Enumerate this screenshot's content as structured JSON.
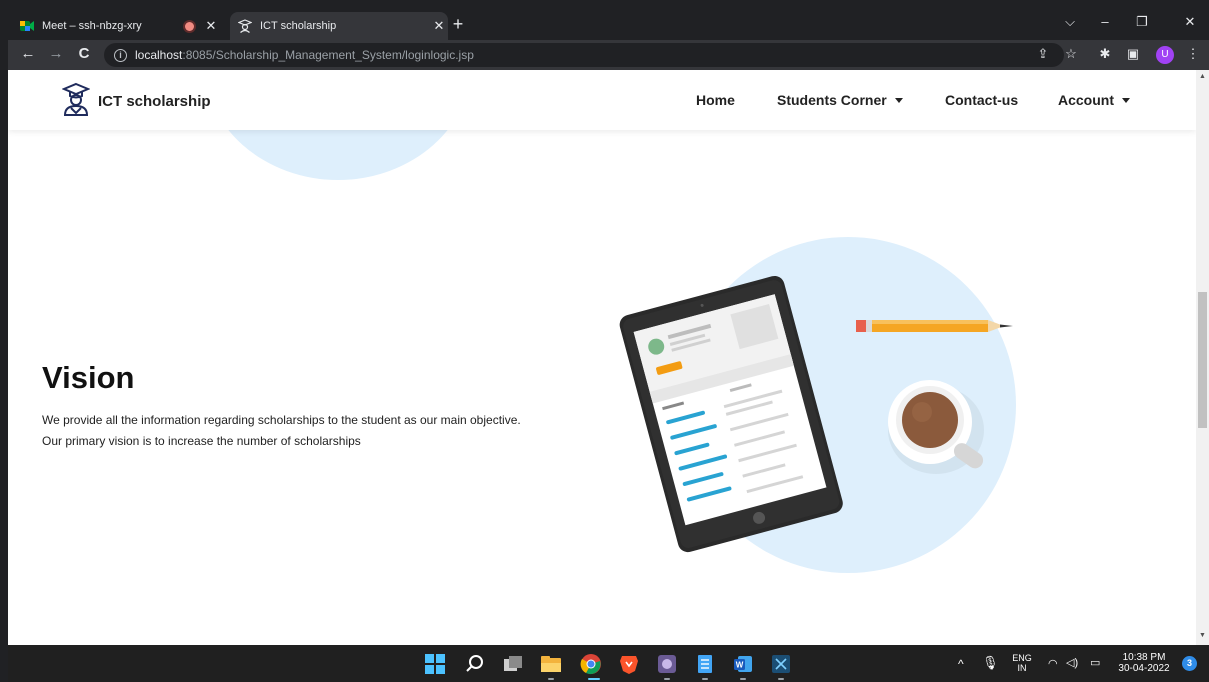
{
  "browser": {
    "tabs": [
      {
        "title": "Meet – ssh-nbzg-xry",
        "icon": "google-meet-icon",
        "recording": true
      },
      {
        "title": "ICT scholarship",
        "icon": "scholar-icon",
        "active": true
      }
    ],
    "new_tab_label": "+",
    "url": {
      "host": "localhost",
      "path": ":8085/Scholarship_Management_System/loginlogic.jsp"
    },
    "profile_initial": "U",
    "window_controls": [
      "chevron-down-icon",
      "minimize-icon",
      "restore-icon",
      "close-icon"
    ]
  },
  "site": {
    "brand": "ICT scholarship",
    "nav": {
      "home": "Home",
      "students_corner": "Students Corner",
      "contact": "Contact-us",
      "account": "Account"
    },
    "vision": {
      "title": "Vision",
      "text": "We provide all the information regarding scholarships to the student as our main objective. Our primary vision is to increase the number of scholarships"
    },
    "colors": {
      "accent_blob": "#deeffc",
      "pencil": "#f5a623",
      "chart_lines": "#29a3d2"
    }
  },
  "taskbar": {
    "apps": [
      "windows-start-icon",
      "search-icon",
      "task-view-icon",
      "file-explorer-icon",
      "chrome-icon",
      "brave-icon",
      "app-icon",
      "notepad-icon",
      "word-icon",
      "snipping-icon"
    ],
    "lang_top": "ENG",
    "lang_bottom": "IN",
    "time": "10:38 PM",
    "date": "30-04-2022",
    "notifications": "3"
  }
}
